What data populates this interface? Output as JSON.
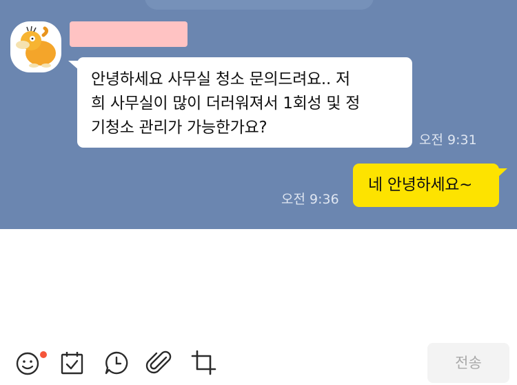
{
  "conversation": {
    "incoming": {
      "sender_name": "",
      "avatar_icon": "psyduck-avatar-icon",
      "lines": [
        "안녕하세요 사무실 청소 문의드려요.. 저",
        "희 사무실이 많이 더러워져서 1회성 및 정",
        "기청소 관리가 가능한가요?"
      ],
      "time": "오전 9:31"
    },
    "outgoing": {
      "text": "네 안녕하세요~",
      "time": "오전 9:36"
    }
  },
  "toolbar": {
    "icons": [
      "emoji-icon",
      "calendar-check-icon",
      "clock-bubble-icon",
      "paperclip-icon",
      "crop-icon"
    ],
    "send_label": "전송"
  },
  "colors": {
    "chat_background": "#6b86b0",
    "incoming_bubble": "#ffffff",
    "outgoing_bubble": "#fde300",
    "notification_dot": "#f5553a",
    "send_button_bg": "#f3f3f3"
  }
}
